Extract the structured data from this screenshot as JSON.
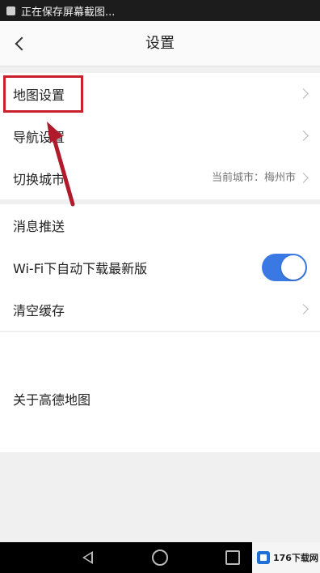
{
  "status_bar": {
    "notification": "正在保存屏幕截图..."
  },
  "header": {
    "title": "设置"
  },
  "group1": {
    "items": [
      {
        "label": "地图设置"
      },
      {
        "label": "导航设置"
      },
      {
        "label": "切换城市",
        "value": "当前城市：梅州市"
      }
    ]
  },
  "group2": {
    "items": [
      {
        "label": "消息推送"
      },
      {
        "label": "Wi-Fi下自动下载最新版",
        "toggle_on": true
      },
      {
        "label": "清空缓存"
      }
    ]
  },
  "group3": {
    "items": [
      {
        "label": "关于高德地图"
      }
    ]
  },
  "annotation": {
    "highlight_color": "#c8202c",
    "arrow_color": "#b01a2a"
  },
  "watermark": {
    "text": "176下载网"
  },
  "colors": {
    "toggle_accent": "#3a79e4"
  }
}
